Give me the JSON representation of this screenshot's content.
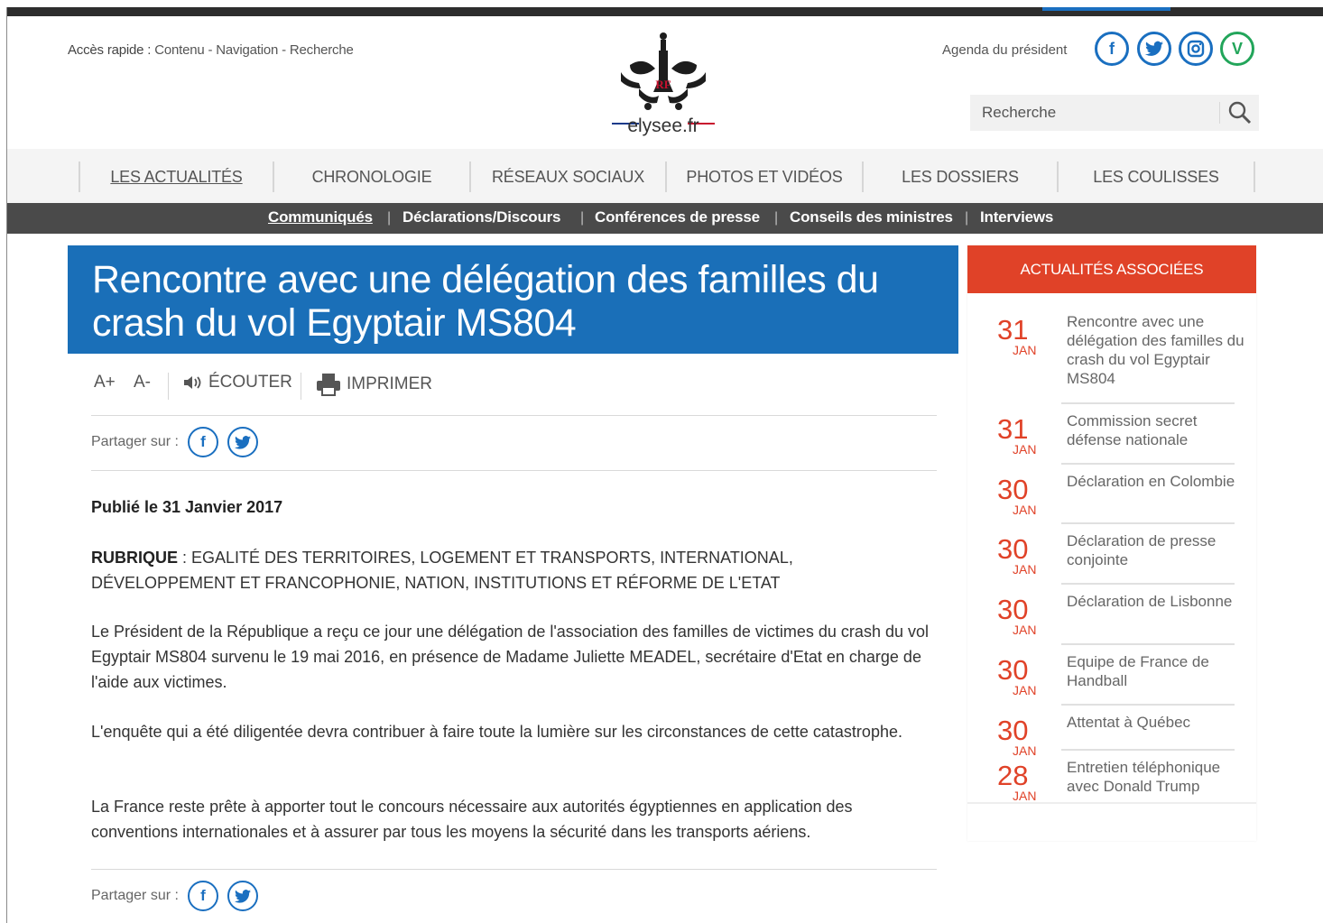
{
  "header": {
    "quick_access_label": "Accès rapide :",
    "quick_links": [
      "Contenu",
      "Navigation",
      "Recherche"
    ],
    "logo_text": "elysee.fr",
    "agenda_link": "Agenda du président",
    "social_icons": [
      "facebook-icon",
      "twitter-icon",
      "instagram-icon",
      "vine-icon"
    ],
    "search_placeholder": "Recherche"
  },
  "main_nav": {
    "items": [
      "LES ACTUALITÉS",
      "CHRONOLOGIE",
      "RÉSEAUX SOCIAUX",
      "PHOTOS ET VIDÉOS",
      "LES DOSSIERS",
      "LES COULISSES"
    ],
    "active": "LES ACTUALITÉS"
  },
  "sub_nav": {
    "items": [
      "Communiqués",
      "Déclarations/Discours",
      "Conférences de presse",
      "Conseils des ministres",
      "Interviews"
    ],
    "active": "Communiqués"
  },
  "article": {
    "title": "Rencontre avec une délégation des familles du crash du vol Egyptair MS804",
    "tools": {
      "font_increase": "A+",
      "font_decrease": "A-",
      "listen": "ÉCOUTER",
      "print": "IMPRIMER"
    },
    "share_label": "Partager sur :",
    "published": "Publié le 31 Janvier 2017",
    "rubrique_label": "RUBRIQUE",
    "rubrique_value": " : EGALITÉ DES TERRITOIRES, LOGEMENT ET TRANSPORTS, INTERNATIONAL, DÉVELOPPEMENT ET FRANCOPHONIE, NATION, INSTITUTIONS ET RÉFORME DE L'ETAT",
    "paragraphs": [
      "Le Président de la République a reçu ce jour une délégation de l'association des familles de victimes du crash du vol Egyptair MS804 survenu le 19 mai 2016, en présence de Madame Juliette MEADEL, secrétaire d'Etat en charge de l'aide aux victimes.",
      "L'enquête qui a été diligentée devra contribuer à faire toute la lumière sur les circonstances de cette catastrophe.",
      "La France reste prête à apporter tout le concours nécessaire aux autorités égyptiennes en application des conventions internationales et à assurer par tous les moyens la sécurité dans les transports aériens."
    ]
  },
  "related": {
    "heading": "ACTUALITÉS ASSOCIÉES",
    "items": [
      {
        "day": "31",
        "month": "JAN",
        "title": "Rencontre avec une délégation des familles du crash du vol Egyptair MS804"
      },
      {
        "day": "31",
        "month": "JAN",
        "title": "Commission secret défense nationale"
      },
      {
        "day": "30",
        "month": "JAN",
        "title": "Déclaration en Colombie"
      },
      {
        "day": "30",
        "month": "JAN",
        "title": "Déclaration de presse conjointe"
      },
      {
        "day": "30",
        "month": "JAN",
        "title": "Déclaration de Lisbonne"
      },
      {
        "day": "30",
        "month": "JAN",
        "title": "Equipe de France de Handball"
      },
      {
        "day": "30",
        "month": "JAN",
        "title": "Attentat à Québec"
      },
      {
        "day": "28",
        "month": "JAN",
        "title": "Entretien téléphonique avec Donald Trump"
      }
    ]
  },
  "colors": {
    "title_blue": "#1a6fb8",
    "accent_red": "#e04228",
    "subnav_bg": "#4a4a4a",
    "social_blue": "#1a6fc0",
    "vine_green": "#22a55a"
  }
}
